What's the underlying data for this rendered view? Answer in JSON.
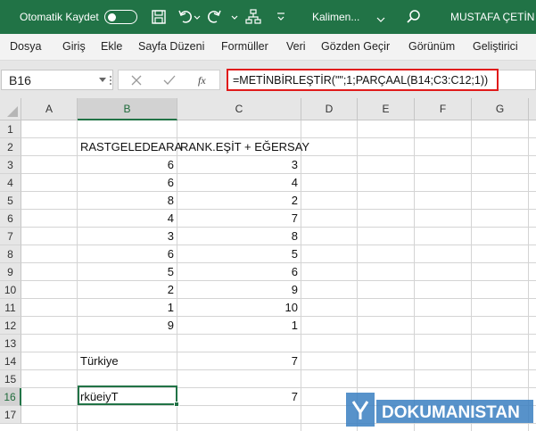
{
  "titlebar": {
    "autosave_label": "Otomatik Kaydet",
    "doc_title": "Kalimen...",
    "user": "MUSTAFA ÇETİN"
  },
  "menu": [
    "Dosya",
    "Giriş",
    "Ekle",
    "Sayfa Düzeni",
    "Formüller",
    "Veri",
    "Gözden Geçir",
    "Görünüm",
    "Geliştirici"
  ],
  "namebox": "B16",
  "formula": "=METİNBİRLEŞTİR(\"\";1;PARÇAAL(B14;C3:C12;1))",
  "columns": [
    "A",
    "B",
    "C",
    "D",
    "E",
    "F",
    "G"
  ],
  "rows": [
    "1",
    "2",
    "3",
    "4",
    "5",
    "6",
    "7",
    "8",
    "9",
    "10",
    "11",
    "12",
    "13",
    "14",
    "15",
    "16",
    "17"
  ],
  "cells": {
    "b2": "RASTGELEDEARA",
    "c2": "RANK.EŞİT + EĞERSAY",
    "b_values": [
      "6",
      "6",
      "8",
      "4",
      "3",
      "6",
      "5",
      "2",
      "1",
      "9"
    ],
    "c_values": [
      "3",
      "4",
      "2",
      "7",
      "8",
      "5",
      "6",
      "9",
      "10",
      "1"
    ],
    "b14": "Türkiye",
    "c14": "7",
    "b16": "rküeiyT",
    "c16": "7"
  },
  "watermark": "DOKUMANISTAN",
  "colors": {
    "accent": "#217346",
    "formula_highlight": "#e01b1b"
  }
}
